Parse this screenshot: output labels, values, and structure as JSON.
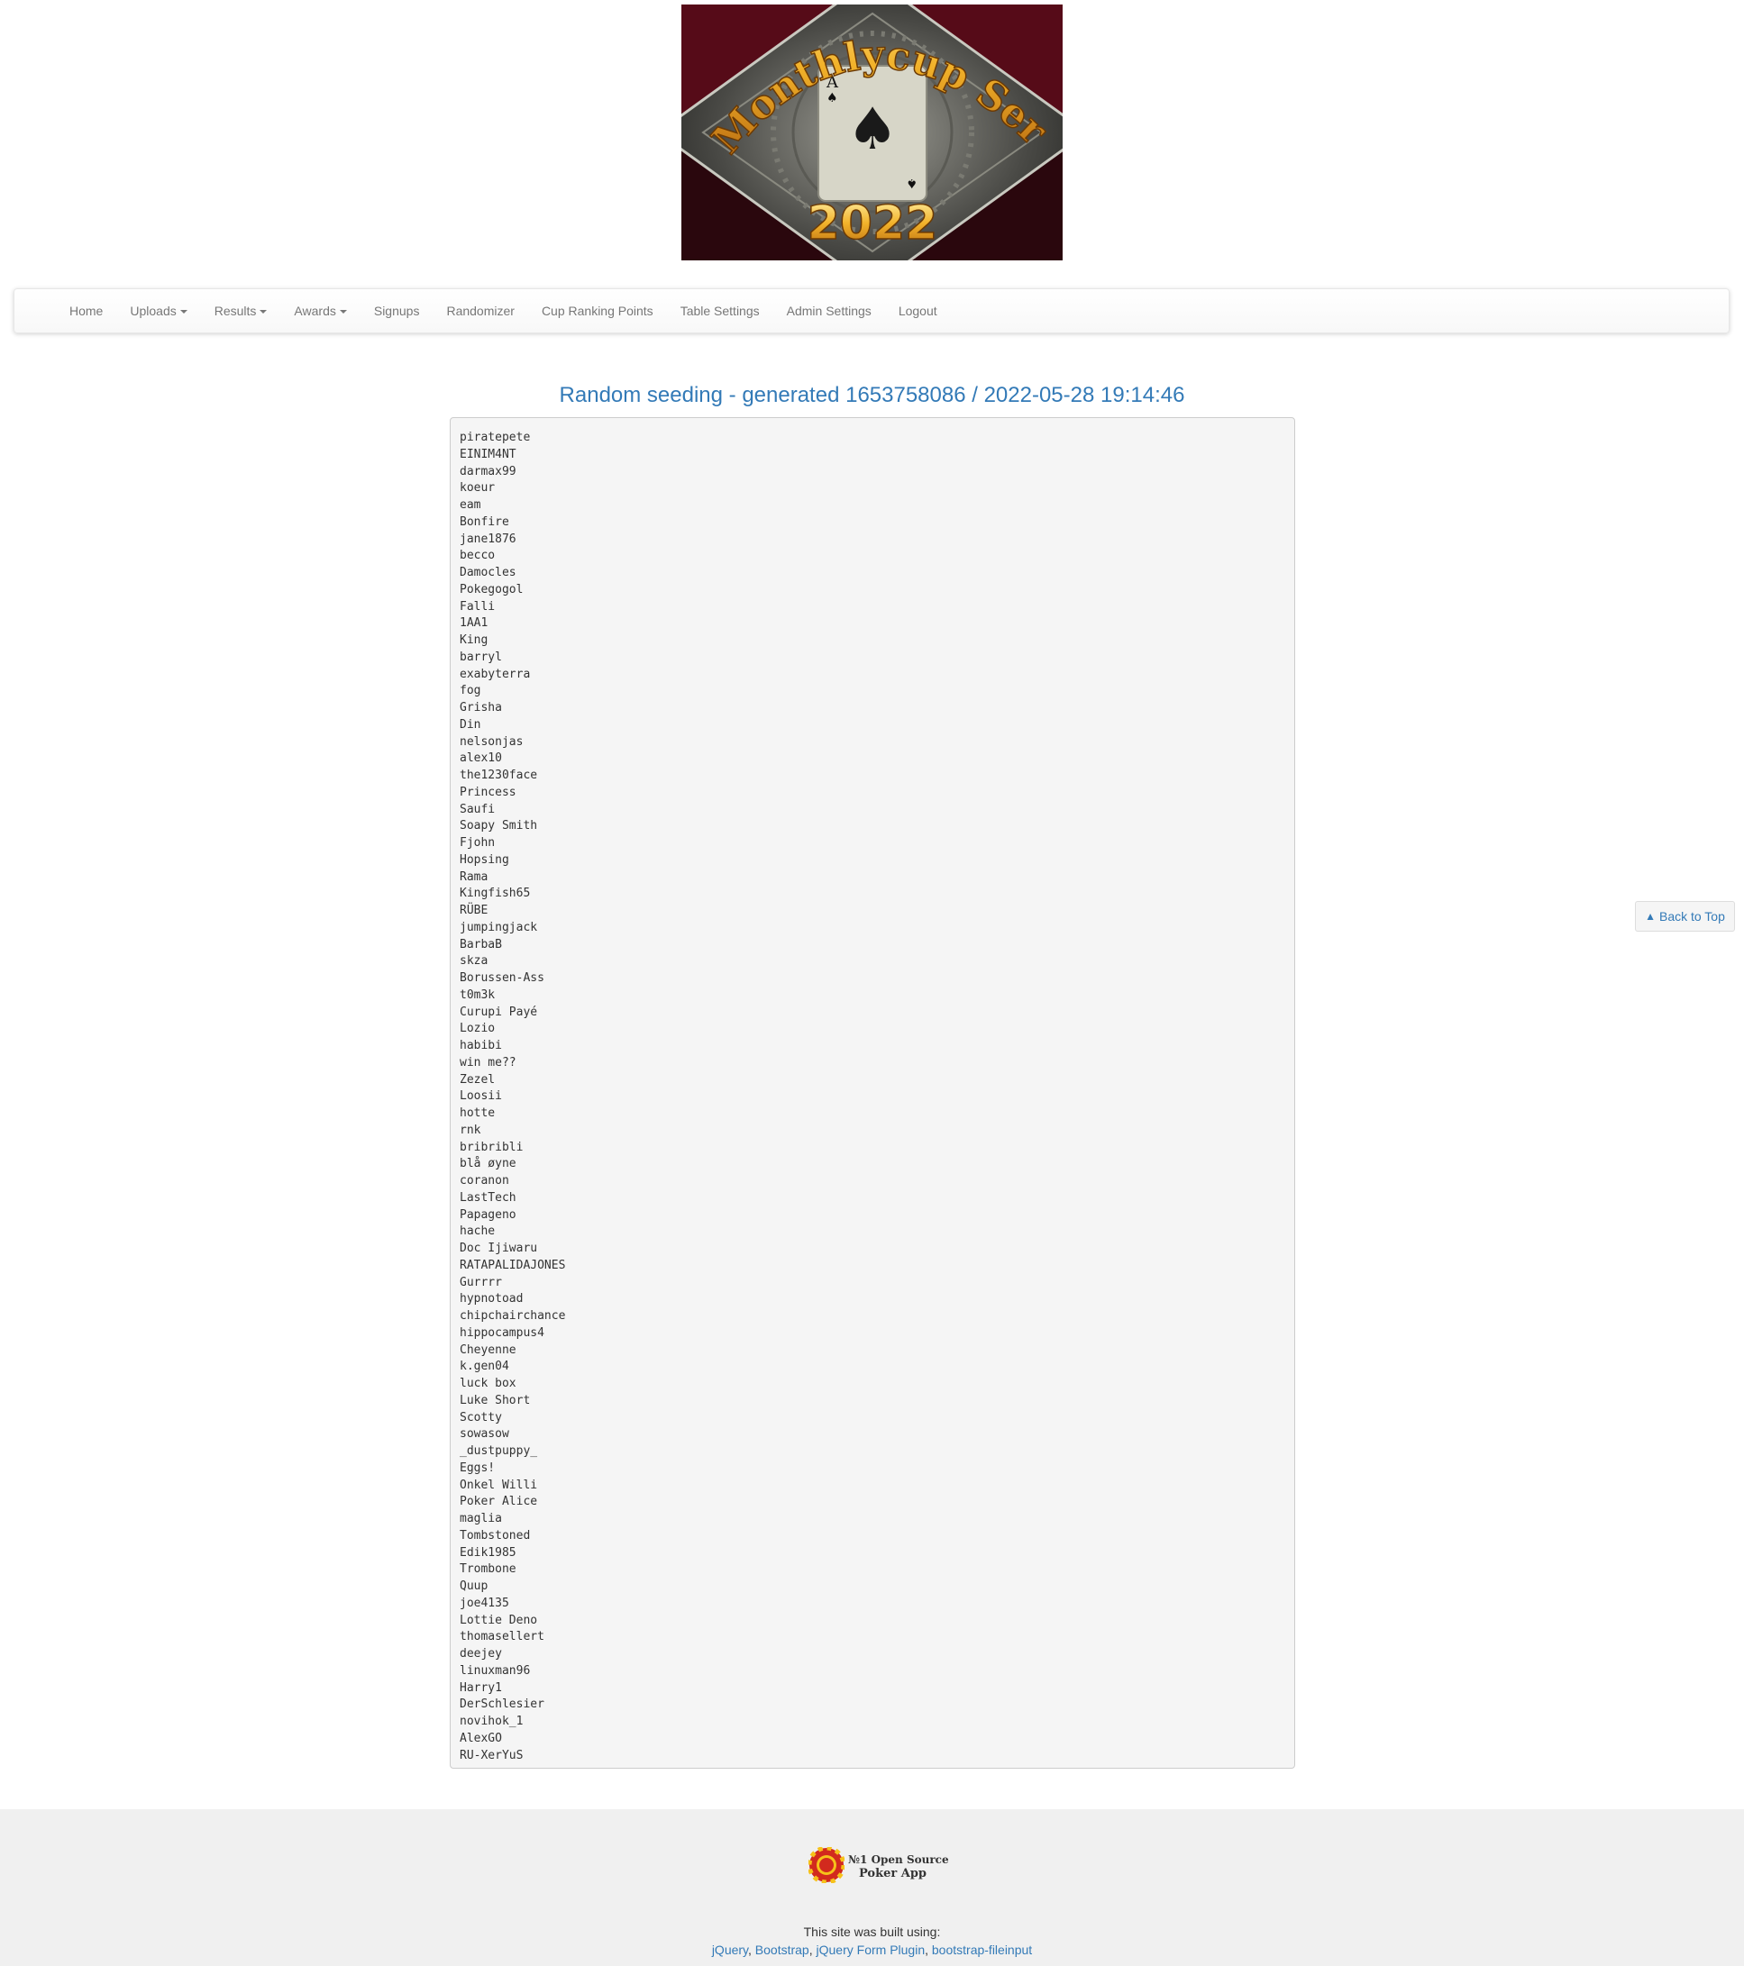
{
  "banner": {
    "title_text": "Monthlycup Series",
    "year_text": "2022",
    "card_rank": "A"
  },
  "nav": {
    "items": [
      {
        "label": "Home",
        "dropdown": false
      },
      {
        "label": "Uploads",
        "dropdown": true
      },
      {
        "label": "Results",
        "dropdown": true
      },
      {
        "label": "Awards",
        "dropdown": true
      },
      {
        "label": "Signups",
        "dropdown": false
      },
      {
        "label": "Randomizer",
        "dropdown": false
      },
      {
        "label": "Cup Ranking Points",
        "dropdown": false
      },
      {
        "label": "Table Settings",
        "dropdown": false
      },
      {
        "label": "Admin Settings",
        "dropdown": false
      },
      {
        "label": "Logout",
        "dropdown": false
      }
    ]
  },
  "page_title": "Random seeding - generated 1653758086 / 2022-05-28 19:14:46",
  "seeding": [
    "piratepete",
    "EINIM4NT",
    "darmax99",
    "koeur",
    "eam",
    "Bonfire",
    "jane1876",
    "becco",
    "Damocles",
    "Pokegogol",
    "Falli",
    "1AA1",
    "King",
    "barryl",
    "exabyterra",
    "fog",
    "Grisha",
    "Din",
    "nelsonjas",
    "alex10",
    "the1230face",
    "Princess",
    "Saufi",
    "Soapy Smith",
    "Fjohn",
    "Hopsing",
    "Rama",
    "Kingfish65",
    "RÜBE",
    "jumpingjack",
    "BarbaB",
    "skza",
    "Borussen-Ass",
    "t0m3k",
    "Curupi Payé",
    "Lozio",
    "habibi",
    "win me??",
    "Zezel",
    "Loosii",
    "hotte",
    "rnk",
    "bribribli",
    "blå øyne",
    "coranon",
    "LastTech",
    "Papageno",
    "hache",
    "Doc Ijiwaru",
    "RATAPALIDAJONES",
    "Gurrrr",
    "hypnotoad",
    "chipchairchance",
    "hippocampus4",
    "Cheyenne",
    "k.gen04",
    "luck box",
    "Luke Short",
    "Scotty",
    "sowasow",
    "_dustpuppy_",
    "Eggs!",
    "Onkel Willi",
    "Poker Alice",
    "maglia",
    "Tombstoned",
    "Edik1985",
    "Trombone",
    "Quup",
    "joe4135",
    "Lottie Deno",
    "thomasellert",
    "deejey",
    "linuxman96",
    "Harry1",
    "DerSchlesier",
    "novihok_1",
    "AlexGO",
    "RU-XerYuS"
  ],
  "back_to_top": {
    "label": "Back to Top",
    "icon": "chevron-up-icon"
  },
  "footer": {
    "logo_line1": "№1 Open Source",
    "logo_line2": "Poker App",
    "built_using": "This site was built using:",
    "links": [
      "jQuery",
      "Bootstrap",
      "jQuery Form Plugin",
      "bootstrap-fileinput"
    ]
  },
  "colors": {
    "link": "#337ab7",
    "nav_text": "#777777",
    "pre_bg": "#f5f5f5",
    "footer_bg": "#f0f0f0"
  }
}
